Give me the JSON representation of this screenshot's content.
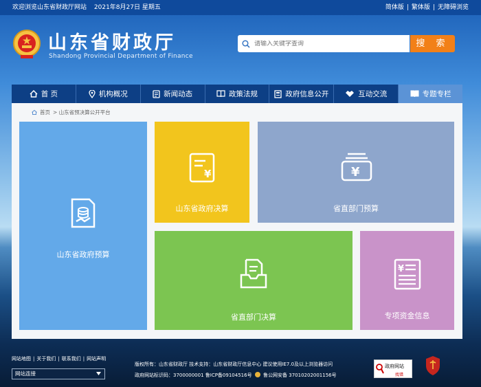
{
  "topbar": {
    "welcome": "欢迎浏览山东省财政厅网站",
    "date": "2021年8月27日 星期五",
    "simplified": "简体版",
    "traditional": "繁体版",
    "accessible": "无障碍浏览",
    "sep": "|"
  },
  "header": {
    "title": "山东省财政厅",
    "subtitle": "Shandong Provincial Department of Finance"
  },
  "search": {
    "placeholder": "请输入关键字查询",
    "button": "搜 索"
  },
  "nav": {
    "items": [
      {
        "label": "首 页",
        "icon": "home-icon"
      },
      {
        "label": "机构概况",
        "icon": "location-icon"
      },
      {
        "label": "新闻动态",
        "icon": "news-icon"
      },
      {
        "label": "政策法规",
        "icon": "book-icon"
      },
      {
        "label": "政府信息公开",
        "icon": "document-icon"
      },
      {
        "label": "互动交流",
        "icon": "handshake-icon"
      },
      {
        "label": "专题专栏",
        "icon": "open-book-icon"
      }
    ]
  },
  "breadcrumb": {
    "home": "首页",
    "current": "> 山东省预决算公开平台"
  },
  "tiles": {
    "t1": "山东省政府预算",
    "t2": "山东省政府决算",
    "t3": "省直部门预算",
    "t4": "省直部门决算",
    "t5": "专项资金信息"
  },
  "footer": {
    "map": "网站地图",
    "about": "关于我们",
    "contact": "联系我们",
    "statement": "网站声明",
    "sep": "|",
    "links_select": "网站连接",
    "line1": "版权所有：山东省财政厅  技术支持：山东省财政厅信息中心  建议使用IE7.0及以上浏览器访问",
    "line2a": "政府网站标识码：3700000001  鲁ICP备09104516号",
    "line2b": "鲁公网安备 37010202001156号",
    "gov_badge_1": "政府网站",
    "gov_badge_2": "找错",
    "party_badge": "党政机关"
  },
  "colors": {
    "accent": "#f28018",
    "nav_bg": "#0d3f85",
    "tile_blue": "#63a9e9",
    "tile_yellow": "#f2c51d",
    "tile_slate": "#8ea6cc",
    "tile_green": "#7cc551",
    "tile_purple": "#c993c9"
  }
}
